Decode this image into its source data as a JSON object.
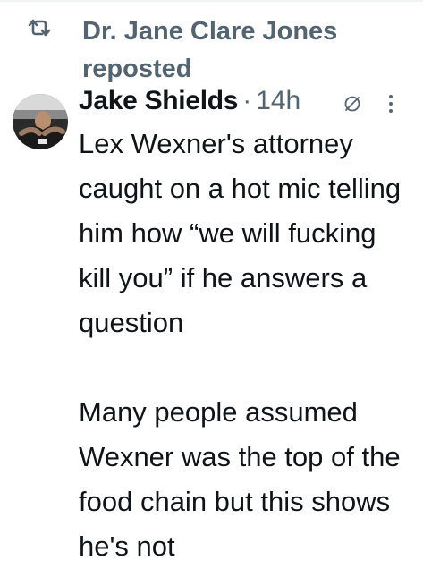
{
  "repost": {
    "icon": "repost-icon",
    "text": "Dr. Jane Clare Jones reposted"
  },
  "author": {
    "name": "Jake Shields",
    "separator": "·",
    "time": "14h",
    "avatar": "avatar-photo",
    "grok_icon": "grok-icon",
    "more_icon": "more-vertical-icon"
  },
  "body": {
    "paragraph_1": "Lex Wexner's attorney caught on a hot mic telling him how “we will fucking kill you” if he answers a question",
    "paragraph_2": "Many people assumed Wexner was the top of the food chain but this shows he's not"
  },
  "colors": {
    "text_primary": "#0f1419",
    "text_secondary": "#536471"
  }
}
